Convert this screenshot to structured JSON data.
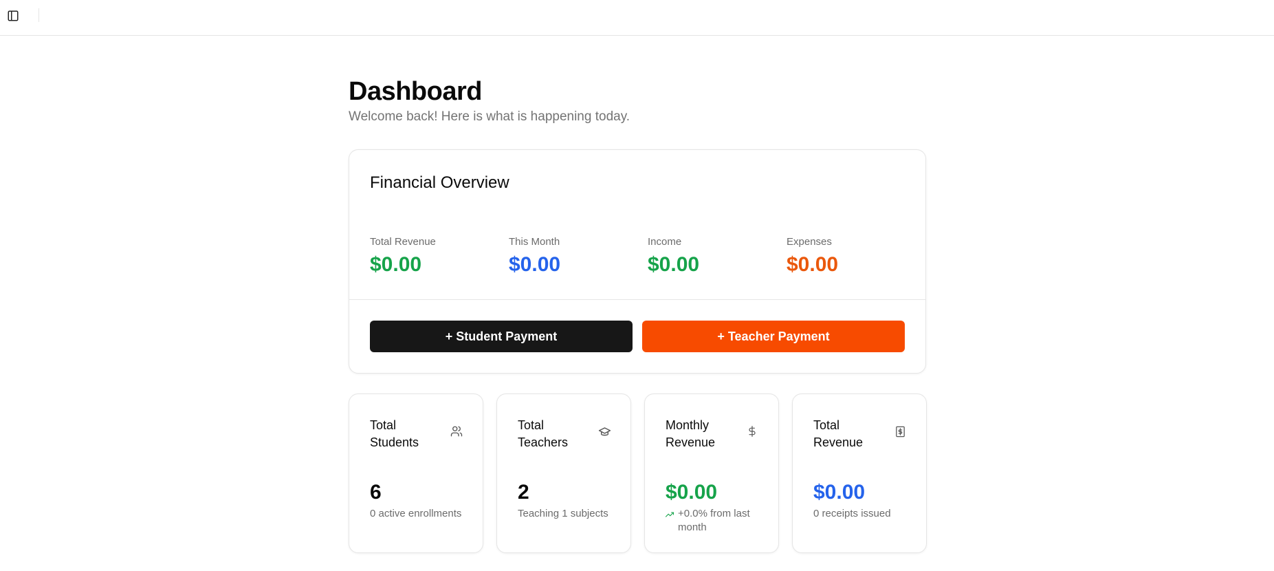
{
  "page": {
    "title": "Dashboard",
    "subtitle": "Welcome back! Here is what is happening today."
  },
  "financial_overview": {
    "title": "Financial Overview",
    "metrics": [
      {
        "label": "Total Revenue",
        "value": "$0.00",
        "color": "#16a34a"
      },
      {
        "label": "This Month",
        "value": "$0.00",
        "color": "#2563eb"
      },
      {
        "label": "Income",
        "value": "$0.00",
        "color": "#16a34a"
      },
      {
        "label": "Expenses",
        "value": "$0.00",
        "color": "#ea580c"
      }
    ],
    "buttons": {
      "student_payment": "+ Student Payment",
      "teacher_payment": "+ Teacher Payment"
    }
  },
  "stats": [
    {
      "title": "Total Students",
      "icon": "users-icon",
      "value": "6",
      "value_color": "#0a0a0a",
      "description": "0 active enrollments"
    },
    {
      "title": "Total Teachers",
      "icon": "graduation-cap-icon",
      "value": "2",
      "value_color": "#0a0a0a",
      "description": "Teaching 1 subjects"
    },
    {
      "title": "Monthly Revenue",
      "icon": "dollar-sign-icon",
      "value": "$0.00",
      "value_color": "#16a34a",
      "description": "+0.0% from last month",
      "trend_icon": "trending-up-icon"
    },
    {
      "title": "Total Revenue",
      "icon": "receipt-icon",
      "value": "$0.00",
      "value_color": "#2563eb",
      "description": "0 receipts issued"
    }
  ],
  "colors": {
    "accent_orange": "#f74b00",
    "dark_button": "#171717",
    "green": "#16a34a",
    "blue": "#2563eb"
  }
}
